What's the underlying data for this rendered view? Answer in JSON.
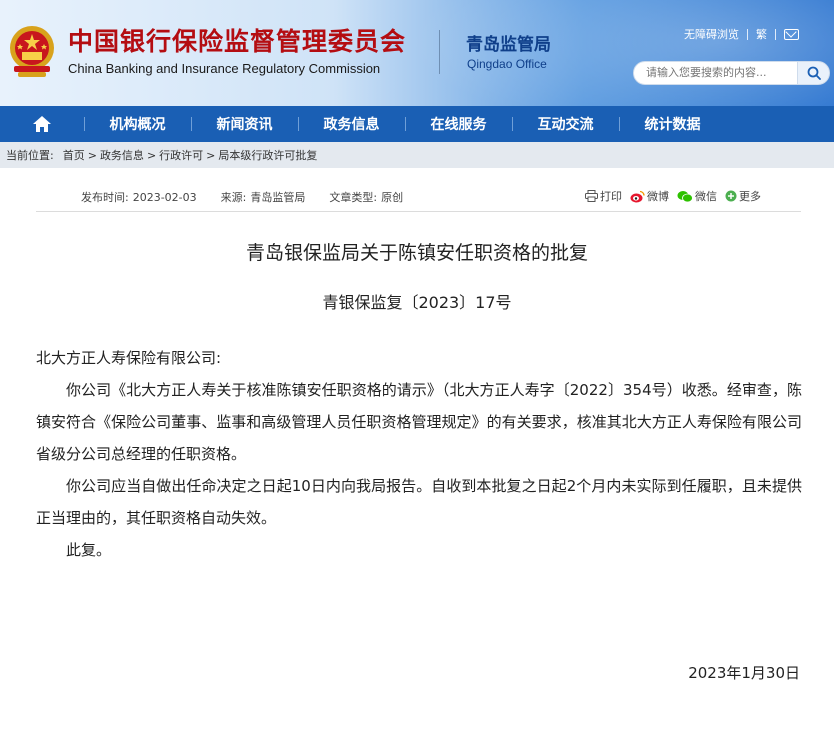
{
  "header": {
    "title_cn": "中国银行保险监督管理委员会",
    "title_en": "China Banking and Insurance Regulatory Commission",
    "office_cn": "青岛监管局",
    "office_en": "Qingdao Office",
    "accessibility_label": "无障碍浏览",
    "traditional_label": "繁",
    "search_placeholder": "请输入您要搜索的内容...",
    "colors": {
      "title_red": "#b40d12",
      "nav_blue": "#1a5fb4"
    }
  },
  "nav": {
    "home_icon": "home-icon",
    "items": [
      {
        "label": "机构概况"
      },
      {
        "label": "新闻资讯"
      },
      {
        "label": "政务信息"
      },
      {
        "label": "在线服务"
      },
      {
        "label": "互动交流"
      },
      {
        "label": "统计数据"
      }
    ]
  },
  "breadcrumb": {
    "prefix": "当前位置:",
    "items": [
      "首页",
      "政务信息",
      "行政许可",
      "局本级行政许可批复"
    ],
    "separator": ">"
  },
  "meta": {
    "publish_label": "发布时间:",
    "publish_date": "2023-02-03",
    "source_label": "来源:",
    "source": "青岛监管局",
    "type_label": "文章类型:",
    "type": "原创"
  },
  "share": {
    "print": "打印",
    "weibo": "微博",
    "wechat": "微信",
    "more": "更多"
  },
  "article": {
    "title": "青岛银保监局关于陈镇安任职资格的批复",
    "number": "青银保监复〔2023〕17号",
    "salutation": "北大方正人寿保险有限公司:",
    "paragraph1": "你公司《北大方正人寿关于核准陈镇安任职资格的请示》（北大方正人寿字〔2022〕354号）收悉。经审查，陈镇安符合《保险公司董事、监事和高级管理人员任职资格管理规定》的有关要求，核准其北大方正人寿保险有限公司省级分公司总经理的任职资格。",
    "paragraph2": "你公司应当自做出任命决定之日起10日内向我局报告。自收到本批复之日起2个月内未实际到任履职，且未提供正当理由的，其任职资格自动失效。",
    "closing": "此复。",
    "date": "2023年1月30日"
  }
}
